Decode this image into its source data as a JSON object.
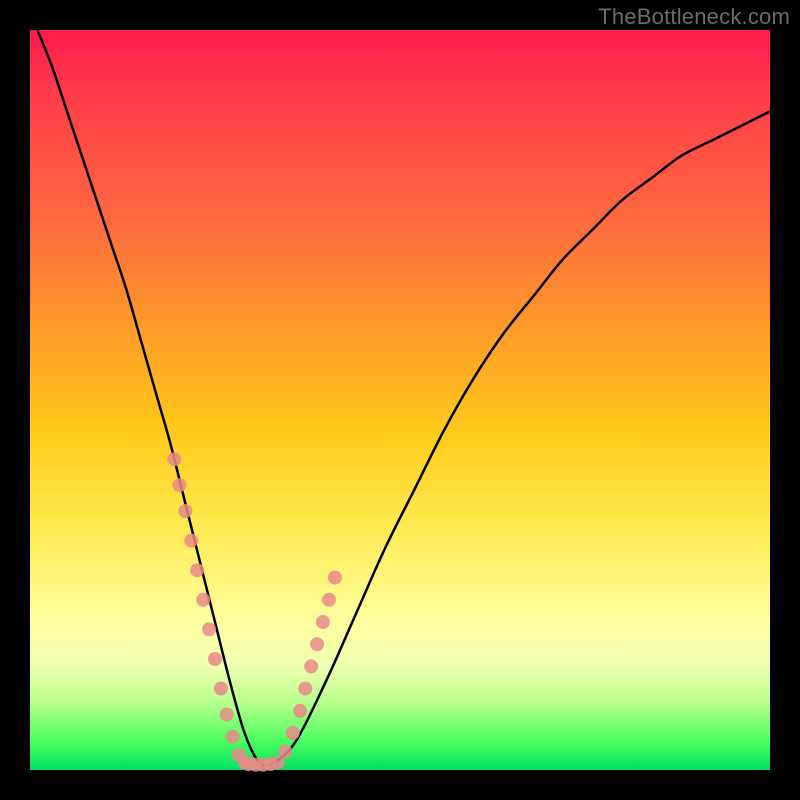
{
  "watermark": "TheBottleneck.com",
  "chart_data": {
    "type": "line",
    "title": "",
    "xlabel": "",
    "ylabel": "",
    "xlim": [
      0,
      100
    ],
    "ylim": [
      0,
      100
    ],
    "grid": false,
    "legend": false,
    "series": [
      {
        "name": "bottleneck-curve",
        "x": [
          1,
          3,
          5,
          7,
          9,
          11,
          13,
          15,
          17,
          19,
          21,
          23,
          25,
          27,
          29,
          31,
          33,
          36,
          40,
          44,
          48,
          52,
          56,
          60,
          64,
          68,
          72,
          76,
          80,
          84,
          88,
          92,
          96,
          100
        ],
        "y": [
          100,
          95,
          89,
          83,
          77,
          71,
          65,
          58,
          51,
          44,
          36,
          28,
          20,
          12,
          5,
          1,
          1,
          4,
          12,
          21,
          30,
          38,
          46,
          53,
          59,
          64,
          69,
          73,
          77,
          80,
          83,
          85,
          87,
          89
        ]
      }
    ],
    "markers": [
      {
        "name": "left-branch-dots",
        "color": "#e88a8a",
        "x": [
          19.5,
          20.2,
          21.0,
          21.8,
          22.6,
          23.4,
          24.2,
          25.0,
          25.8,
          26.6,
          27.4,
          28.2,
          29.0
        ],
        "y": [
          42.0,
          38.5,
          35.0,
          31.0,
          27.0,
          23.0,
          19.0,
          15.0,
          11.0,
          7.5,
          4.5,
          2.0,
          1.0
        ]
      },
      {
        "name": "bottom-dots",
        "color": "#e88a8a",
        "x": [
          29.5,
          30.5,
          31.5,
          32.5,
          33.5
        ],
        "y": [
          0.8,
          0.7,
          0.7,
          0.8,
          1.0
        ]
      },
      {
        "name": "right-branch-dots",
        "color": "#e88a8a",
        "x": [
          34.5,
          35.5,
          36.5,
          37.2,
          38.0,
          38.8,
          39.6,
          40.4,
          41.2
        ],
        "y": [
          2.5,
          5.0,
          8.0,
          11.0,
          14.0,
          17.0,
          20.0,
          23.0,
          26.0
        ]
      }
    ],
    "gradient_stops": [
      {
        "pos": 0,
        "color": "#ff1a4f"
      },
      {
        "pos": 26,
        "color": "#ff6a3e"
      },
      {
        "pos": 54,
        "color": "#ffc91a"
      },
      {
        "pos": 80,
        "color": "#ffffa0"
      },
      {
        "pos": 100,
        "color": "#00e060"
      }
    ]
  }
}
